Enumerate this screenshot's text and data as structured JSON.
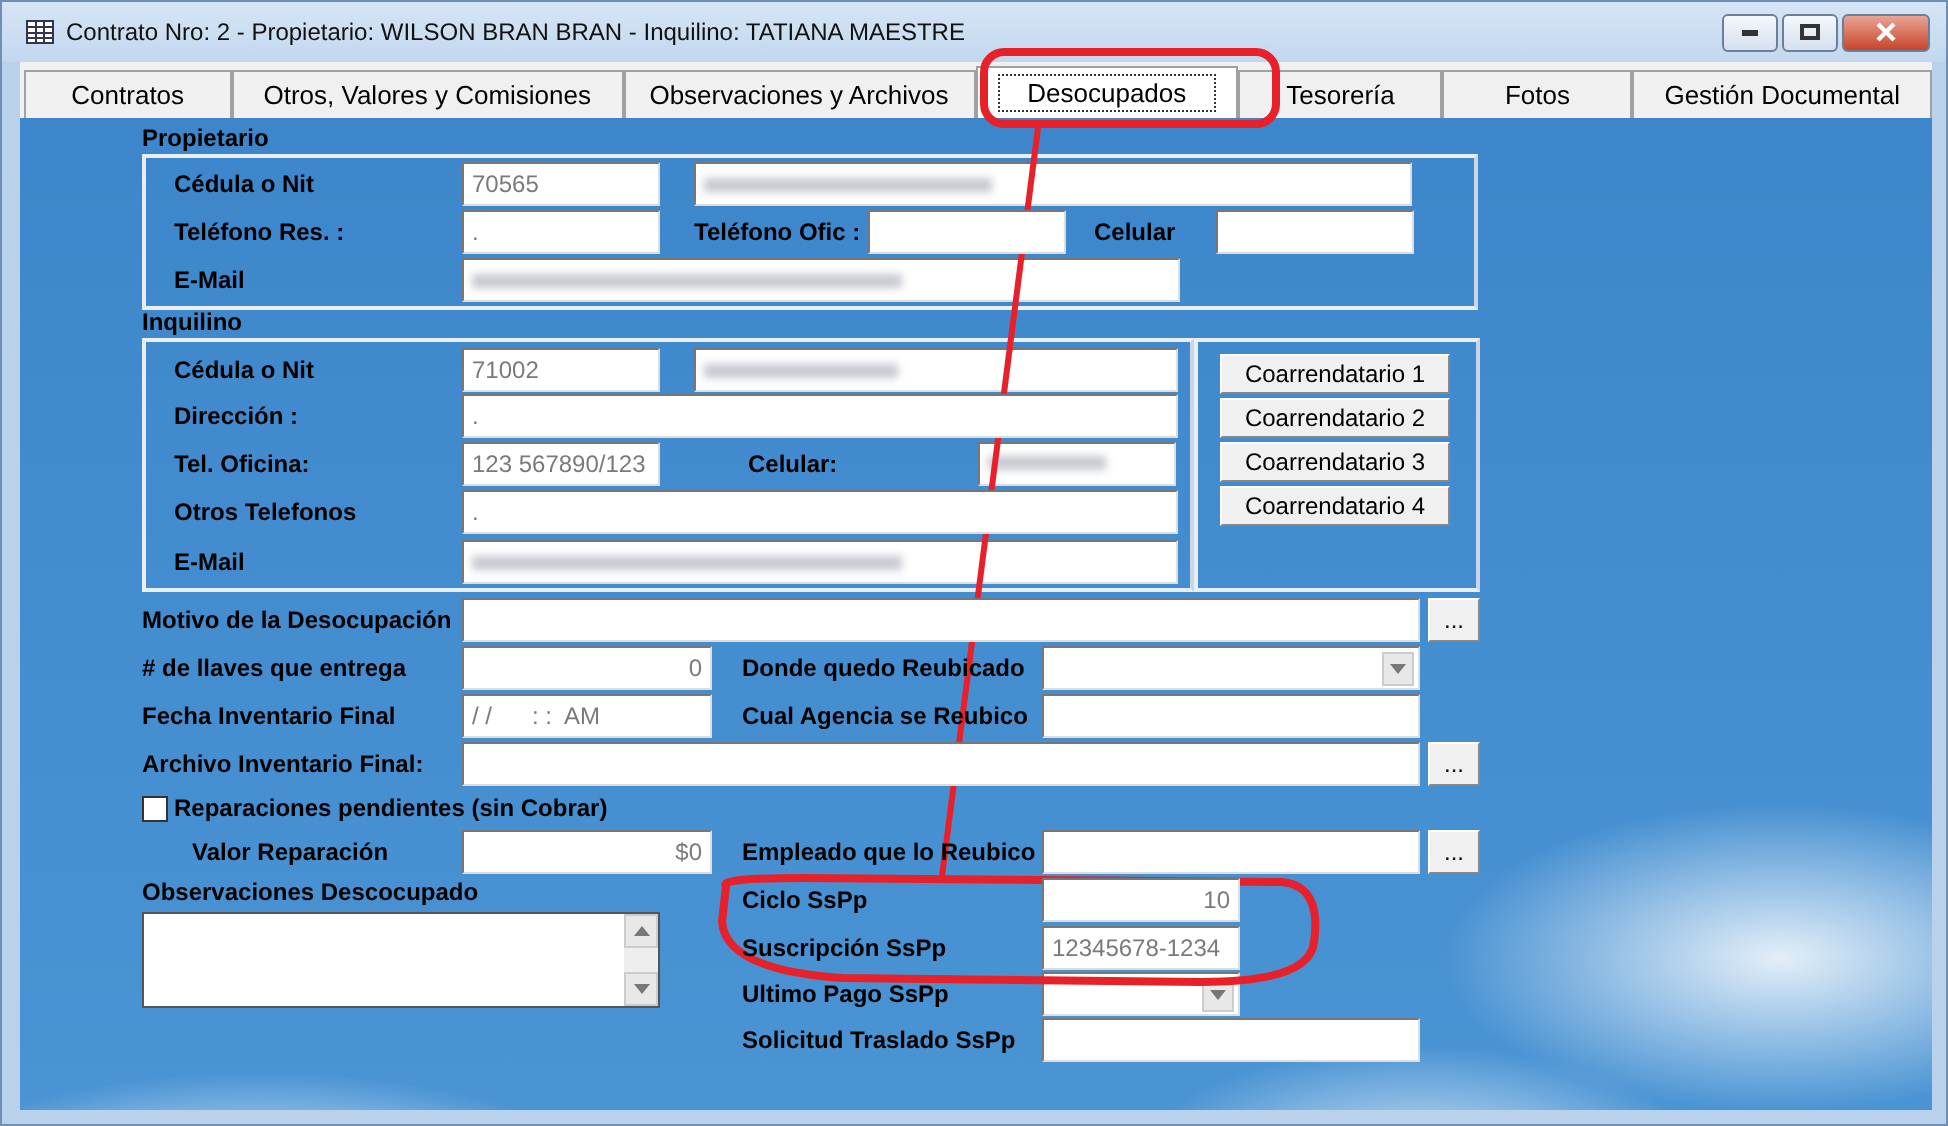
{
  "window": {
    "title": "Contrato Nro: 2 - Propietario: WILSON BRAN BRAN - Inquilino: TATIANA MAESTRE"
  },
  "tabs": [
    {
      "label": "Contratos",
      "selected": false
    },
    {
      "label": "Otros, Valores y Comisiones",
      "selected": false
    },
    {
      "label": "Observaciones y Archivos",
      "selected": false
    },
    {
      "label": "Desocupados",
      "selected": true
    },
    {
      "label": "Tesorería",
      "selected": false
    },
    {
      "label": "Fotos",
      "selected": false
    },
    {
      "label": "Gestión Documental",
      "selected": false
    }
  ],
  "propietario": {
    "heading": "Propietario",
    "cedula": {
      "label": "Cédula o Nit",
      "value": "70565",
      "name_redacted": true
    },
    "telefono_res": {
      "label": "Teléfono Res. :",
      "value": "."
    },
    "telefono_ofic": {
      "label": "Teléfono Ofic :"
    },
    "celular": {
      "label": "Celular"
    },
    "email": {
      "label": "E-Mail",
      "redacted": true
    }
  },
  "inquilino": {
    "heading": "Inquilino",
    "cedula": {
      "label": "Cédula o Nit",
      "value": "71002",
      "name_redacted": true
    },
    "direccion": {
      "label": "Dirección :",
      "value": "."
    },
    "tel_oficina": {
      "label": "Tel. Oficina:",
      "value": "123 567890/123"
    },
    "celular": {
      "label": "Celular:",
      "redacted": true
    },
    "otros_telefonos": {
      "label": "Otros Telefonos",
      "value": "."
    },
    "email": {
      "label": "E-Mail",
      "redacted": true
    },
    "buttons": [
      "Coarrendatario 1",
      "Coarrendatario 2",
      "Coarrendatario 3",
      "Coarrendatario 4"
    ]
  },
  "desocupacion": {
    "motivo": {
      "label": "Motivo de la Desocupación",
      "browse": "..."
    },
    "llaves": {
      "label": "# de llaves que entrega",
      "value": "0"
    },
    "donde_reubicado": {
      "label": "Donde quedo Reubicado"
    },
    "fecha_inventario": {
      "label": "Fecha Inventario Final",
      "value": "/ /      : :  AM"
    },
    "agencia": {
      "label": "Cual Agencia se Reubico"
    },
    "archivo": {
      "label": "Archivo Inventario Final:",
      "browse": "..."
    },
    "reparaciones": {
      "label": "Reparaciones pendientes (sin Cobrar)",
      "checked": false
    },
    "valor_reparacion": {
      "label": "Valor Reparación",
      "value": "$0"
    },
    "empleado": {
      "label": "Empleado que lo Reubico",
      "browse": "..."
    },
    "observaciones": {
      "label": "Observaciones Descocupado"
    },
    "ciclo": {
      "label": "Ciclo SsPp",
      "value": "10"
    },
    "suscripcion": {
      "label": "Suscripción SsPp",
      "value": "12345678-1234"
    },
    "ultimo_pago": {
      "label": "Ultimo Pago SsPp"
    },
    "solicitud_traslado": {
      "label": "Solicitud Traslado SsPp"
    }
  }
}
